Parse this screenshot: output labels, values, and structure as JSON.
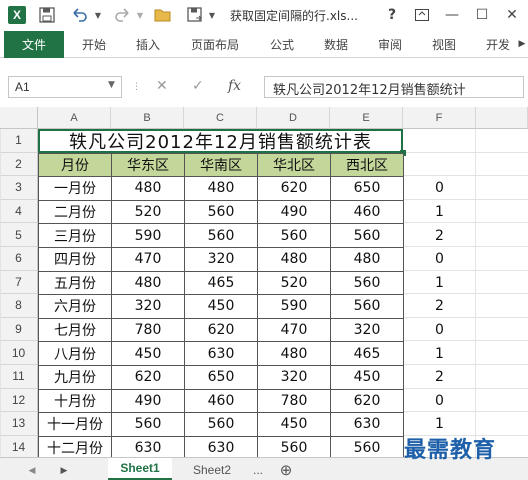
{
  "titlebar": {
    "title": "获取固定间隔的行.xls...",
    "logo_letter": "X",
    "help": "?",
    "min": "—",
    "max": "☐",
    "close": "✕"
  },
  "ribbon": {
    "tabs": [
      "文件",
      "开始",
      "插入",
      "页面布局",
      "公式",
      "数据",
      "审阅",
      "视图",
      "开发"
    ]
  },
  "formula_bar": {
    "name_box": "A1",
    "cancel_icon": "✕",
    "enter_icon": "✓",
    "fx": "fx",
    "value": "轶凡公司2012年12月销售额统计"
  },
  "grid": {
    "columns": [
      "A",
      "B",
      "C",
      "D",
      "E",
      "F"
    ],
    "rows": [
      "1",
      "2",
      "3",
      "4",
      "5",
      "6",
      "7",
      "8",
      "9",
      "10",
      "11",
      "12",
      "13",
      "14"
    ],
    "title": "轶凡公司2012年12月销售额统计表",
    "headers": [
      "月份",
      "华东区",
      "华南区",
      "华北区",
      "西北区"
    ],
    "data": [
      [
        "一月份",
        "480",
        "480",
        "620",
        "650",
        "0"
      ],
      [
        "二月份",
        "520",
        "560",
        "490",
        "460",
        "1"
      ],
      [
        "三月份",
        "590",
        "560",
        "560",
        "560",
        "2"
      ],
      [
        "四月份",
        "470",
        "320",
        "480",
        "480",
        "0"
      ],
      [
        "五月份",
        "480",
        "465",
        "520",
        "560",
        "1"
      ],
      [
        "六月份",
        "320",
        "450",
        "590",
        "560",
        "2"
      ],
      [
        "七月份",
        "780",
        "620",
        "470",
        "320",
        "0"
      ],
      [
        "八月份",
        "450",
        "630",
        "480",
        "465",
        "1"
      ],
      [
        "九月份",
        "620",
        "650",
        "320",
        "450",
        "2"
      ],
      [
        "十月份",
        "490",
        "460",
        "780",
        "620",
        "0"
      ],
      [
        "十一月份",
        "560",
        "560",
        "450",
        "630",
        "1"
      ],
      [
        "十二月份",
        "630",
        "630",
        "560",
        "560",
        ""
      ]
    ]
  },
  "sheets": {
    "tabs": [
      "Sheet1",
      "Sheet2"
    ],
    "active": "Sheet1",
    "more": "...",
    "add": "⊕"
  },
  "watermark": "最需教育"
}
